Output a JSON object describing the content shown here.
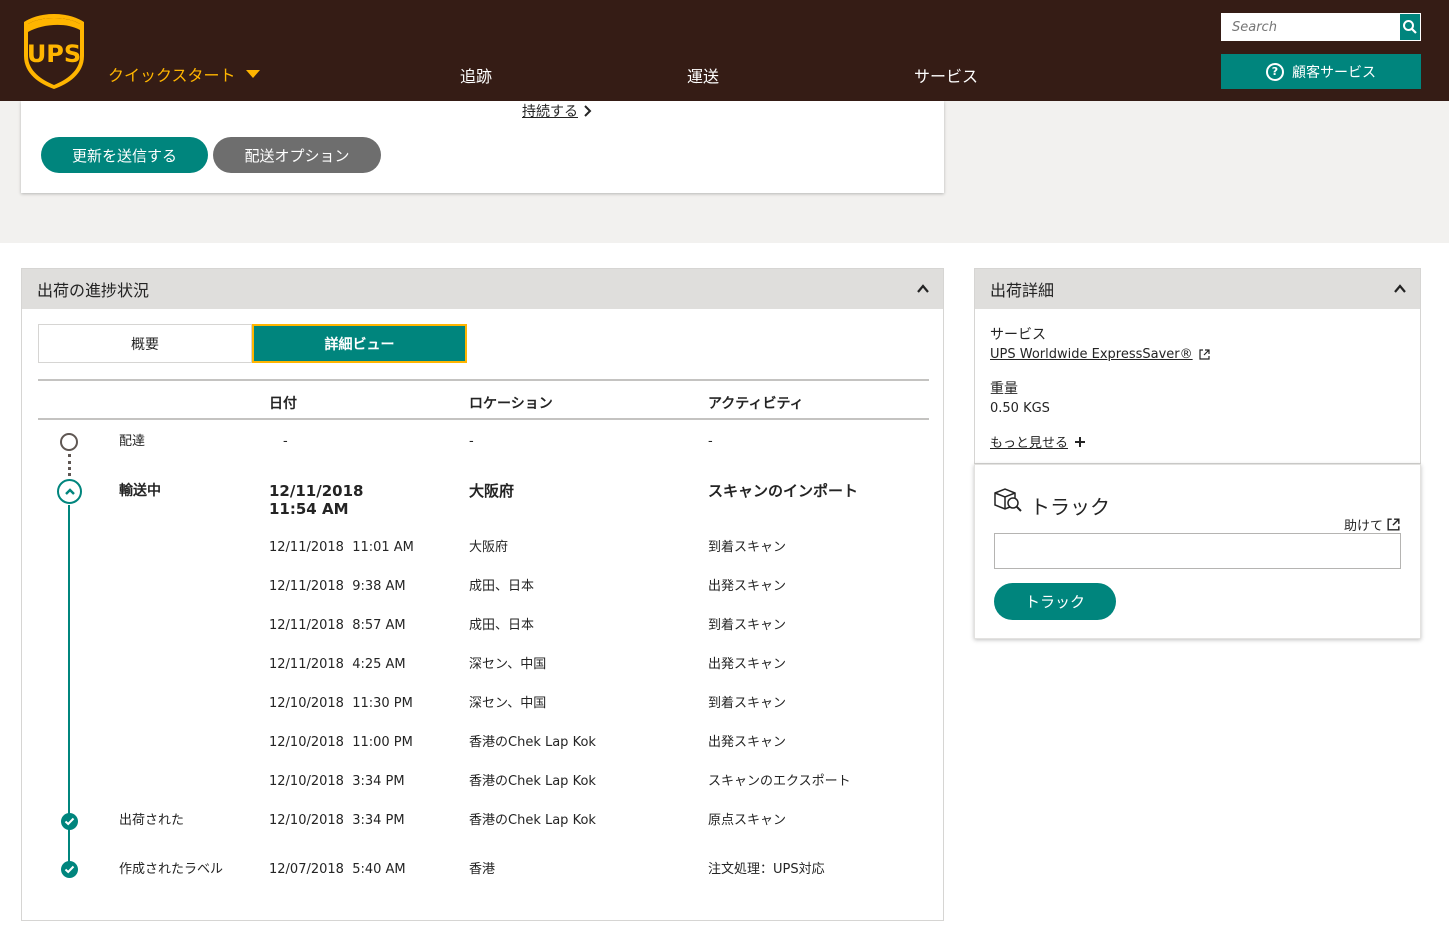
{
  "header": {
    "brand": "UPS",
    "quickstart_label": "クイックスタート",
    "nav": [
      "追跡",
      "運送",
      "サービス"
    ],
    "search_placeholder": "Search",
    "customer_service_label": "顧客サービス",
    "colors": {
      "brown": "#351c15",
      "gold": "#ffb500",
      "green": "#00857d"
    }
  },
  "top_card": {
    "continue_link": "持続する",
    "submit_update_label": "更新を送信する",
    "delivery_options_label": "配送オプション"
  },
  "progress": {
    "title": "出荷の進捗状況",
    "tabs": {
      "summary": "概要",
      "detail": "詳細ビュー"
    },
    "columns": {
      "date": "日付",
      "location": "ロケーション",
      "activity": "アクティビティ"
    },
    "rows": [
      {
        "status": "配達",
        "date": "-",
        "location": "-",
        "activity": "-"
      },
      {
        "status": "輸送中",
        "date": "12/11/2018\n11:54 AM",
        "location": "大阪府",
        "activity": "スキャンのインポート"
      },
      {
        "status": "",
        "date": "12/11/2018  11:01 AM",
        "location": "大阪府",
        "activity": "到着スキャン"
      },
      {
        "status": "",
        "date": "12/11/2018  9:38 AM",
        "location": "成田、日本",
        "activity": "出発スキャン"
      },
      {
        "status": "",
        "date": "12/11/2018  8:57 AM",
        "location": "成田、日本",
        "activity": "到着スキャン"
      },
      {
        "status": "",
        "date": "12/11/2018  4:25 AM",
        "location": "深セン、中国",
        "activity": "出発スキャン"
      },
      {
        "status": "",
        "date": "12/10/2018  11:30 PM",
        "location": "深セン、中国",
        "activity": "到着スキャン"
      },
      {
        "status": "",
        "date": "12/10/2018  11:00 PM",
        "location": "香港のChek Lap Kok",
        "activity": "出発スキャン"
      },
      {
        "status": "",
        "date": "12/10/2018  3:34 PM",
        "location": "香港のChek Lap Kok",
        "activity": "スキャンのエクスポート"
      },
      {
        "status": "出荷された",
        "date": "12/10/2018  3:34 PM",
        "location": "香港のChek Lap Kok",
        "activity": "原点スキャン"
      },
      {
        "status": "作成されたラベル",
        "date": "12/07/2018  5:40 AM",
        "location": "香港",
        "activity": "注文処理：UPS対応"
      }
    ]
  },
  "details": {
    "title": "出荷詳細",
    "service_label": "サービス",
    "service_value": "UPS Worldwide ExpressSaver®",
    "weight_label": "重量",
    "weight_value": "0.50 KGS",
    "more_label": "もっと見せる"
  },
  "track": {
    "title": "トラック",
    "help_label": "助けて",
    "button_label": "トラック"
  }
}
